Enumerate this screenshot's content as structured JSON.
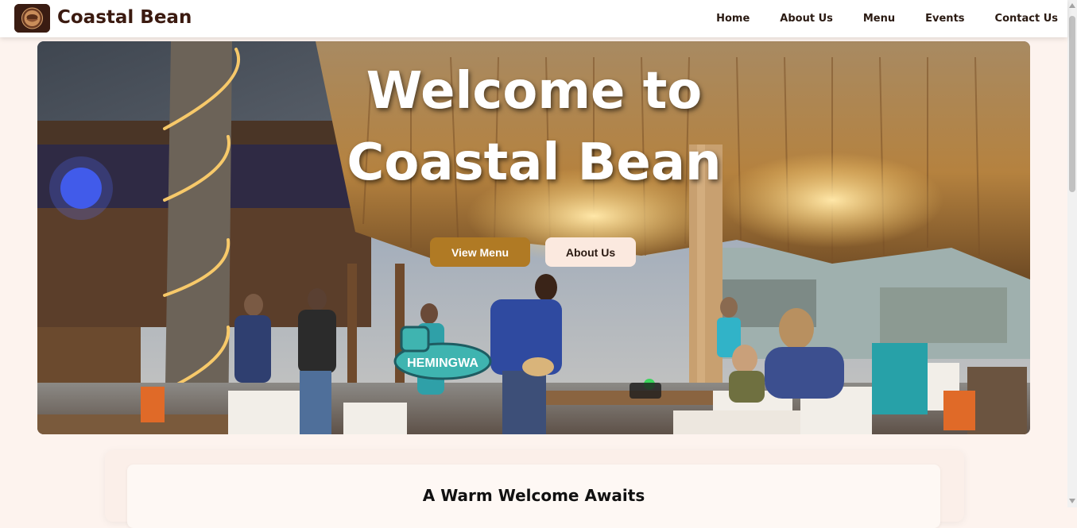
{
  "brand": {
    "name": "Coastal Bean",
    "logo_icon": "coffee-cup-logo-icon"
  },
  "nav": {
    "items": [
      {
        "label": "Home"
      },
      {
        "label": "About Us"
      },
      {
        "label": "Menu"
      },
      {
        "label": "Events"
      },
      {
        "label": "Contact Us"
      }
    ]
  },
  "hero": {
    "title": "Welcome to Coastal Bean",
    "primary_button": "View Menu",
    "secondary_button": "About Us",
    "sign_text": "HEMINGWA"
  },
  "welcome": {
    "title": "A Warm Welcome Awaits"
  },
  "colors": {
    "brand": "#3b1a10",
    "accent": "#b07a24",
    "background": "#fdf3ee",
    "secondary_button": "#fbe9df"
  }
}
